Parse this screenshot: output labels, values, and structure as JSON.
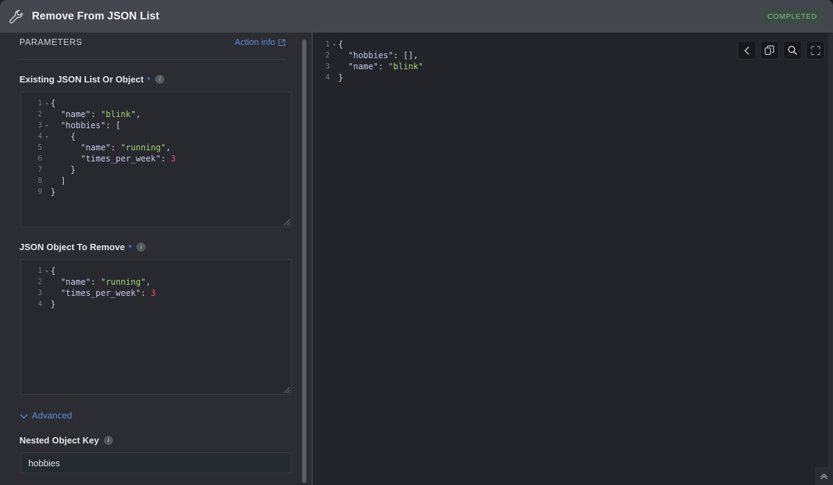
{
  "header": {
    "icon": "wrench-icon",
    "title": "Remove From JSON List",
    "status": "COMPLETED",
    "status_color": "#72c58a",
    "status_bg": "#3c4c44"
  },
  "params": {
    "section_label": "PARAMETERS",
    "action_info_label": "Action info",
    "action_info_icon": "external-link-icon"
  },
  "fields": {
    "existing": {
      "label": "Existing JSON List Or Object",
      "required_marker": "*",
      "info_icon": "info-icon",
      "lines": [
        {
          "num": "1",
          "fold": "▾",
          "html": "{"
        },
        {
          "num": "2",
          "fold": "",
          "html": "  \"name\": \"blink\","
        },
        {
          "num": "3",
          "fold": "▾",
          "html": "  \"hobbies\": ["
        },
        {
          "num": "4",
          "fold": "▾",
          "html": "    {"
        },
        {
          "num": "5",
          "fold": "",
          "html": "      \"name\": \"running\","
        },
        {
          "num": "6",
          "fold": "",
          "html": "      \"times_per_week\": 3"
        },
        {
          "num": "7",
          "fold": "",
          "html": "    }"
        },
        {
          "num": "8",
          "fold": "",
          "html": "  ]"
        },
        {
          "num": "9",
          "fold": "",
          "html": "}"
        }
      ]
    },
    "remove": {
      "label": "JSON Object To Remove",
      "required_marker": "*",
      "info_icon": "info-icon",
      "lines": [
        {
          "num": "1",
          "fold": "▾",
          "html": "{"
        },
        {
          "num": "2",
          "fold": "",
          "html": "  \"name\": \"running\","
        },
        {
          "num": "3",
          "fold": "",
          "html": "  \"times_per_week\": 3"
        },
        {
          "num": "4",
          "fold": "",
          "html": "}"
        }
      ]
    },
    "advanced": {
      "label": "Advanced",
      "chevron": "chevron-down-icon"
    },
    "nested_key": {
      "label": "Nested Object Key",
      "info_icon": "info-icon",
      "value": "hobbies",
      "placeholder": ""
    }
  },
  "output": {
    "lines": [
      {
        "num": "1",
        "fold": "▾",
        "html": "{"
      },
      {
        "num": "2",
        "fold": "",
        "html": "  \"hobbies\": [],"
      },
      {
        "num": "3",
        "fold": "",
        "html": "  \"name\": \"blink\""
      },
      {
        "num": "4",
        "fold": "",
        "html": "}"
      }
    ],
    "toolbar": [
      {
        "name": "back-chevron-icon",
        "label": ""
      },
      {
        "name": "copy-icon",
        "label": ""
      },
      {
        "name": "search-icon",
        "label": ""
      },
      {
        "name": "fullscreen-icon",
        "label": ""
      }
    ]
  },
  "footer": {
    "collapse_icon": "double-chevron-up-icon"
  },
  "colors": {
    "header_bg": "#44464d",
    "panel_bg": "#2b2d32",
    "editor_bg": "#27292e",
    "output_bg": "#222429",
    "accent_link": "#5b8dd9",
    "json_key": "#c7cae8",
    "json_string": "#a6d472",
    "json_number": "#e2526e",
    "json_punct": "#cdd0d4"
  }
}
